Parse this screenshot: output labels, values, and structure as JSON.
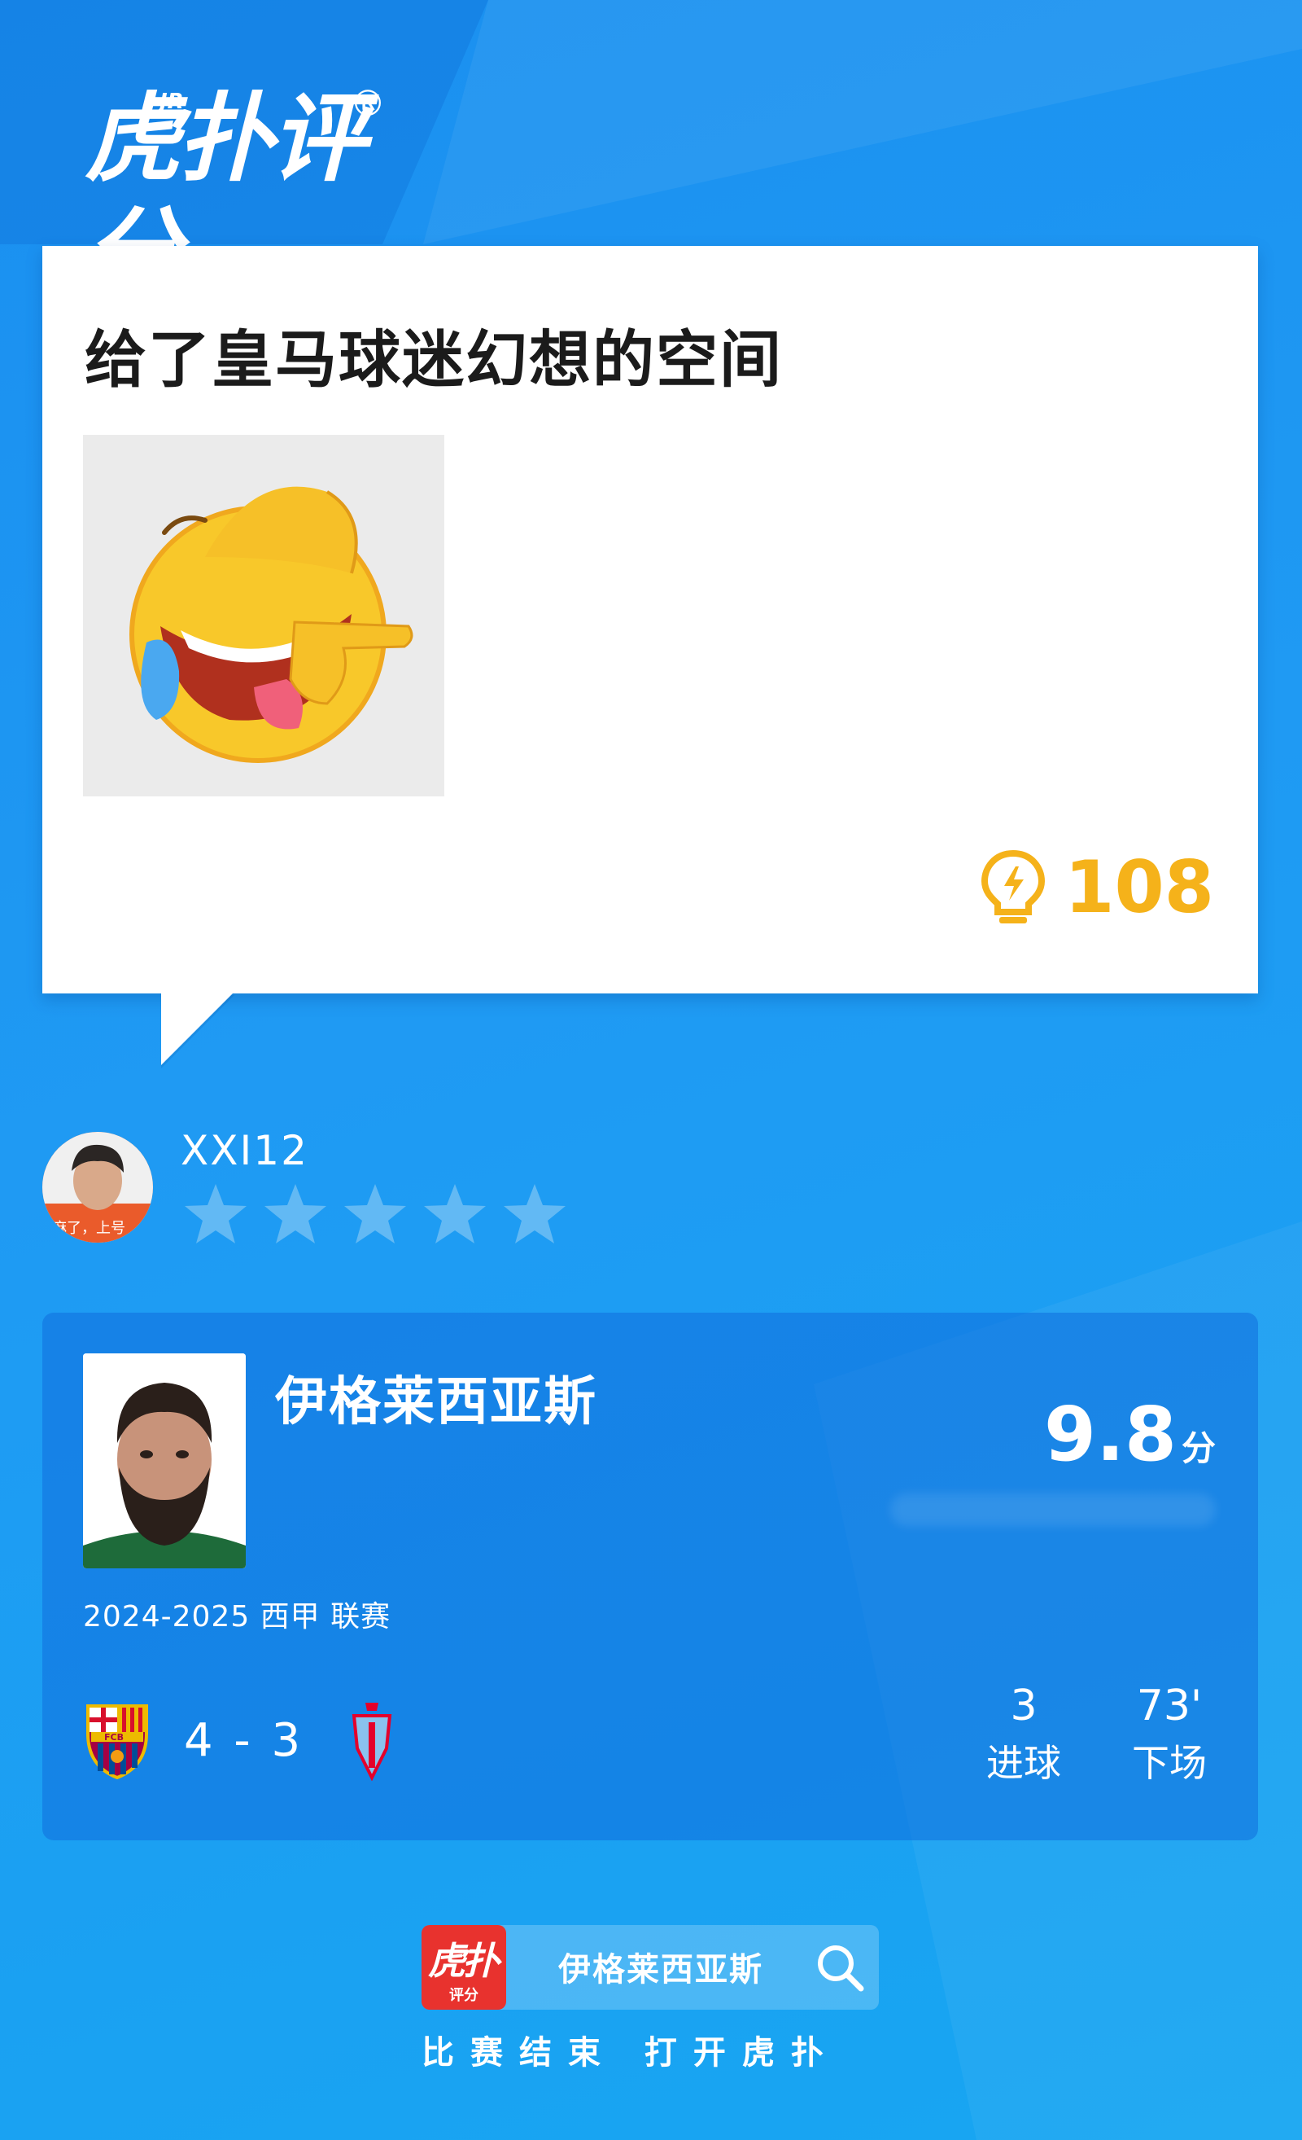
{
  "brand": {
    "logo_text": "虎扑评分",
    "logo_sup": "JR",
    "logo_mark": "®"
  },
  "comment": {
    "text": "给了皇马球迷幻想的空间",
    "likes": "108"
  },
  "user": {
    "name": "XXI12",
    "avatar_caption": "麻了，上号",
    "rating_stars": 5
  },
  "player": {
    "name": "伊格莱西亚斯",
    "score": "9.8",
    "score_unit": "分",
    "season": "2024-2025 西甲 联赛",
    "match": {
      "home": "FCB",
      "score": "4 - 3"
    },
    "stats": [
      {
        "value": "3",
        "label": "进球"
      },
      {
        "value": "73'",
        "label": "下场"
      }
    ]
  },
  "search": {
    "logo_text": "虎扑",
    "logo_sub": "评分",
    "query": "伊格莱西亚斯"
  },
  "footer": {
    "text": "比赛结束 打开虎扑"
  },
  "colors": {
    "background": "#1f9af3",
    "accent": "#f5b21a",
    "star": "#5fb8f5"
  }
}
